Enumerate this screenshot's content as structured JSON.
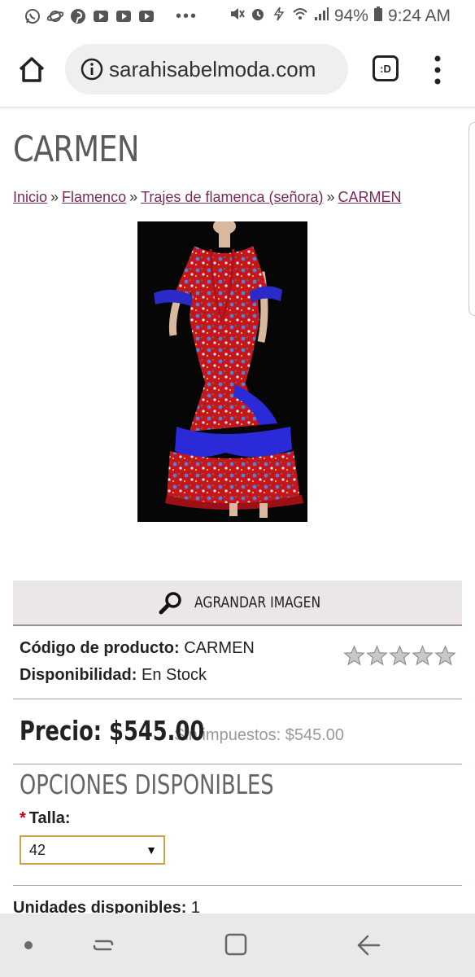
{
  "status_bar": {
    "battery": "94%",
    "time": "9:24 AM",
    "dots": "•••",
    "left_icons": [
      "whatsapp-icon",
      "saturn-icon",
      "pinterest-icon",
      "youtube-icon",
      "youtube-icon",
      "youtube-icon"
    ]
  },
  "browser": {
    "url": "sarahisabelmoda.com",
    "tab_badge": ":D"
  },
  "page": {
    "title": "CARMEN",
    "breadcrumb": {
      "items": [
        "Inicio",
        "Flamenco",
        "Trajes de flamenca (señora)",
        "CARMEN"
      ],
      "separator": "»"
    },
    "enlarge_label": "AGRANDAR IMAGEN",
    "product_code_label": "Código de producto:",
    "product_code_value": "CARMEN",
    "availability_label": "Disponibilidad:",
    "availability_value": "En Stock",
    "rating": {
      "value": 0,
      "max": 5
    },
    "price_label": "Precio: $545.00",
    "price_without_tax": "Sin impuestos: $545.00",
    "options_title": "OPCIONES DISPONIBLES",
    "talla_required_marker": "*",
    "talla_label": "Talla:",
    "talla_selected": "42",
    "units_label": "Unidades disponibles:",
    "units_value": "1"
  },
  "colors": {
    "link": "#7a2a5a",
    "divider": "#b89aa8",
    "enlarge_bg": "#ebe6e8",
    "select_border": "#c9a24a",
    "required": "#cc0000"
  }
}
